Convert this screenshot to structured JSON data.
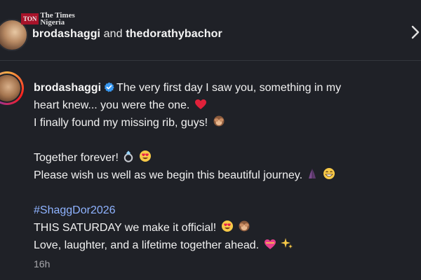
{
  "watermark": {
    "badge": "TON",
    "line1": "The Times",
    "line2": "Nigeria"
  },
  "header": {
    "user1": "brodashaggi",
    "conjunction": "and",
    "user2": "thedorathybachor"
  },
  "post": {
    "username": "brodashaggi",
    "line1": "The very first day I saw you, something in my",
    "line2": "heart knew... you were the one.",
    "line3": "I finally found my missing rib, guys!",
    "line4": "Together forever!",
    "line5": "Please wish us well as we begin this beautiful journey.",
    "hashtag": "#ShaggDor2026",
    "line6": "THIS SATURDAY we make it official!",
    "line7": "Love, laughter, and a lifetime together ahead.",
    "timestamp": "16h"
  },
  "colors": {
    "background": "#1f2127",
    "hashtag": "#8fb3ff",
    "verified": "#3897f0",
    "timestamp": "#a8a8ad"
  },
  "icons": {
    "chevron": "chevron-right-icon",
    "verified": "verified-badge-icon"
  }
}
